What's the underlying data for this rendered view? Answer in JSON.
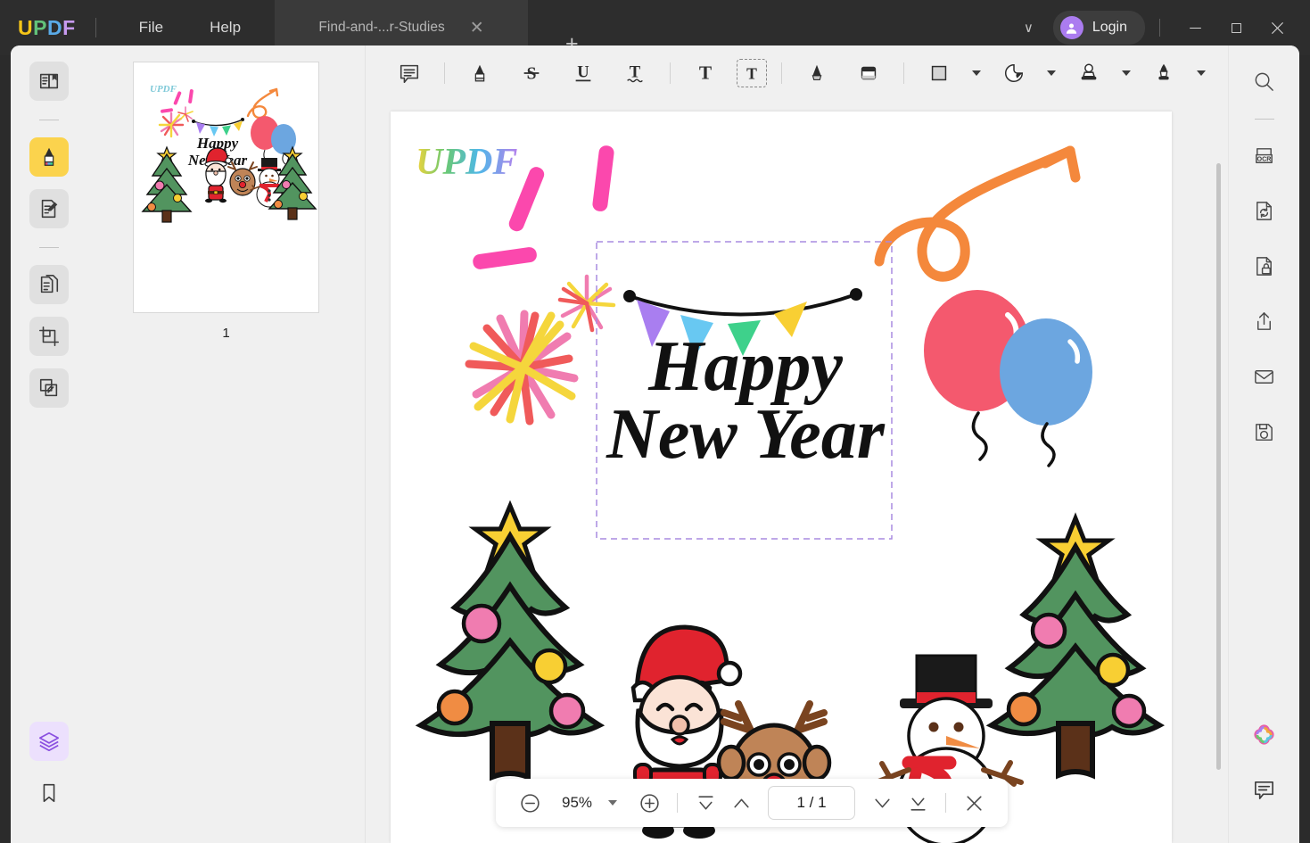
{
  "app": {
    "name": "UPDF",
    "logo_letters": [
      "U",
      "P",
      "D",
      "F"
    ],
    "logo_colors": [
      "#f5c518",
      "#62c27a",
      "#5aabe8",
      "#c89bf0"
    ]
  },
  "titlebar": {
    "menus": [
      {
        "label": "File",
        "name": "menu-file"
      },
      {
        "label": "Help",
        "name": "menu-help"
      }
    ],
    "tab": {
      "title": "Find-and-...r-Studies",
      "close_label": "✕",
      "new_tab_label": "+"
    },
    "chevron_label": "∨",
    "login_label": "Login",
    "window_controls": {
      "minimize": "minimize-button",
      "maximize": "maximize-button",
      "close": "close-button"
    }
  },
  "left_rail": {
    "items": [
      {
        "name": "reader-mode-icon",
        "label": "Reader",
        "state": "tile"
      },
      {
        "name": "annotate-highlighter-icon",
        "label": "Annotate",
        "state": "active-yellow"
      },
      {
        "name": "edit-pdf-icon",
        "label": "Edit PDF",
        "state": "tile"
      },
      {
        "name": "organize-pages-icon",
        "label": "Organize Pages",
        "state": "tile"
      },
      {
        "name": "crop-page-icon",
        "label": "Crop",
        "state": "tile"
      },
      {
        "name": "compare-documents-icon",
        "label": "Compare",
        "state": "tile"
      }
    ],
    "bottom_items": [
      {
        "name": "layers-icon",
        "label": "Layers",
        "state": "active-purple"
      },
      {
        "name": "bookmark-icon",
        "label": "Bookmark",
        "state": "plain"
      }
    ]
  },
  "thumbnails": {
    "pages": [
      {
        "number": "1",
        "name": "page-thumbnail-1"
      }
    ]
  },
  "toolbar": {
    "groups": [
      {
        "tools": [
          {
            "name": "sticky-note-icon",
            "label": "Note"
          }
        ]
      },
      {
        "tools": [
          {
            "name": "highlight-icon",
            "label": "Highlight"
          },
          {
            "name": "strikethrough-icon",
            "label": "Strikethrough",
            "glyph": "S"
          },
          {
            "name": "underline-icon",
            "label": "Underline",
            "glyph": "U"
          },
          {
            "name": "squiggly-underline-icon",
            "label": "Squiggly",
            "glyph": "T"
          }
        ]
      },
      {
        "tools": [
          {
            "name": "text-box-icon",
            "label": "Text",
            "glyph": "T"
          },
          {
            "name": "text-callout-icon",
            "label": "Text Box",
            "glyph": "T"
          }
        ]
      },
      {
        "tools": [
          {
            "name": "pencil-icon",
            "label": "Pencil"
          },
          {
            "name": "eraser-icon",
            "label": "Eraser"
          }
        ]
      },
      {
        "tools": [
          {
            "name": "shapes-icon",
            "label": "Shapes",
            "has_caret": true
          },
          {
            "name": "sticker-icon",
            "label": "Stickers",
            "has_caret": true
          },
          {
            "name": "stamp-icon",
            "label": "Stamp",
            "has_caret": true
          },
          {
            "name": "signature-icon",
            "label": "Signature",
            "has_caret": true
          }
        ]
      }
    ]
  },
  "right_rail": {
    "items": [
      {
        "name": "search-icon",
        "label": "Search"
      },
      {
        "name": "ocr-icon",
        "label": "OCR"
      },
      {
        "name": "convert-pdf-icon",
        "label": "Convert"
      },
      {
        "name": "protect-pdf-icon",
        "label": "Protect"
      },
      {
        "name": "share-icon",
        "label": "Share"
      },
      {
        "name": "email-icon",
        "label": "Email"
      },
      {
        "name": "save-icon",
        "label": "Save"
      }
    ],
    "bottom_items": [
      {
        "name": "ai-assistant-icon",
        "label": "UPDF AI"
      },
      {
        "name": "comment-panel-icon",
        "label": "Comments"
      }
    ]
  },
  "zoombar": {
    "zoom_out_label": "−",
    "zoom_level": "95%",
    "zoom_in_label": "+",
    "first_page_label": "first-page",
    "prev_page_label": "previous-page",
    "page_indicator": "1 / 1",
    "next_page_label": "next-page",
    "last_page_label": "last-page",
    "close_label": "✕"
  },
  "document": {
    "watermark": "UPDF",
    "headline_line1": "Happy",
    "headline_line2": "New Year",
    "selection_active": true,
    "colors": {
      "bunting": [
        "#a97ef0",
        "#68c8f2",
        "#3ed18b",
        "#f8cf33"
      ],
      "balloon_red": "#f4596e",
      "balloon_blue": "#6ca6e0",
      "tree_green": "#52945f",
      "tree_trunk": "#5b3119",
      "star_yellow": "#f8cf33",
      "santa_red": "#e0232e",
      "reindeer_brown": "#bf8457",
      "arrow_orange": "#f4883c",
      "confetti_pink": "#fb48ad",
      "selection_border": "#a98be0"
    },
    "ornaments": [
      {
        "color": "#f07cb0"
      },
      {
        "color": "#f8cf33"
      },
      {
        "color": "#f08c43"
      },
      {
        "color": "#f07cb0"
      }
    ]
  }
}
